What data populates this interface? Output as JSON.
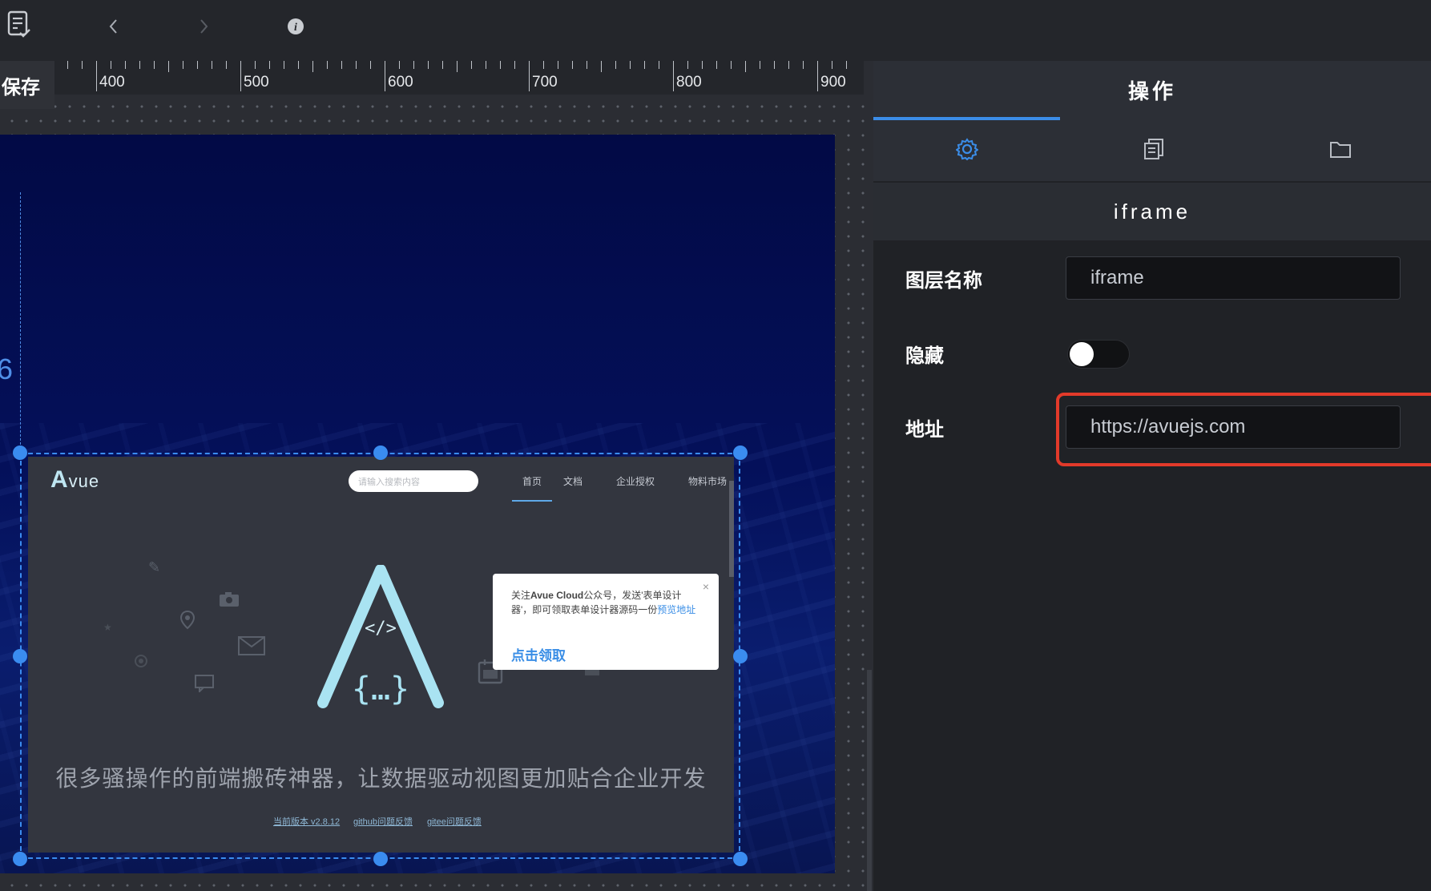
{
  "toolbar": {
    "icons": [
      "checklist-icon",
      "chevron-left-icon",
      "chevron-right-icon",
      "info-icon"
    ]
  },
  "canvas": {
    "save_label": "保存",
    "ruler_labels": [
      "400",
      "500",
      "600",
      "700",
      "800",
      "900"
    ],
    "guide_label": "6"
  },
  "iframe_preview": {
    "logo_big": "A",
    "logo_small": "vue",
    "search_placeholder": "请输入搜索内容",
    "nav": [
      "首页",
      "文档",
      "企业授权",
      "物料市场"
    ],
    "popup": {
      "text_before": "关注",
      "brand": "Avue Cloud",
      "text_after": "公众号，发送'表单设计器'，即可领取表单设计器源码一份",
      "link": "预览地址",
      "button": "点击领取",
      "close": "×"
    },
    "slogan": "很多骚操作的前端搬砖神器，让数据驱动视图更加贴合企业开发",
    "links": [
      "当前版本 v2.8.12",
      "github问题反馈",
      "gitee问题反馈"
    ]
  },
  "panel": {
    "title": "操作",
    "tabs": [
      "settings-icon",
      "copy-icon",
      "folder-icon"
    ],
    "active_tab": 0,
    "section_title": "iframe",
    "fields": {
      "layer_name_label": "图层名称",
      "layer_name_value": "iframe",
      "hidden_label": "隐藏",
      "hidden_value": false,
      "address_label": "地址",
      "address_value": "https://avuejs.com"
    }
  },
  "colors": {
    "accent": "#3b8de8",
    "highlight": "#e23a2a",
    "canvas_bg": "#020a45"
  }
}
